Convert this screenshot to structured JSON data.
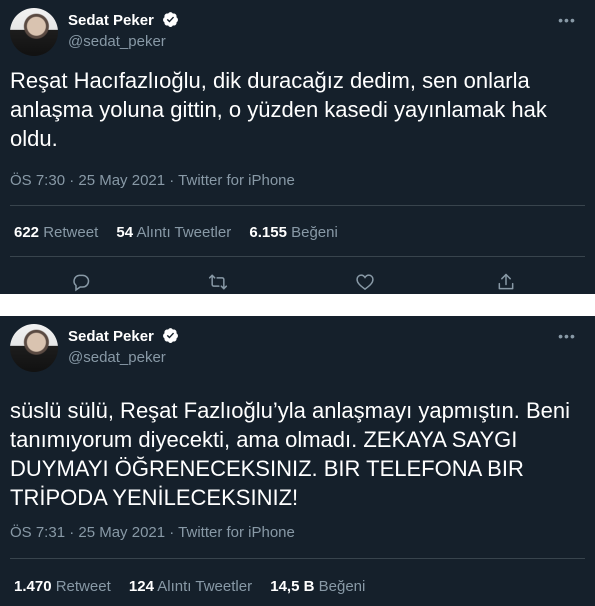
{
  "tweets": [
    {
      "display_name": "Sedat Peker",
      "handle": "@sedat_peker",
      "text": "Reşat Hacıfazlıoğlu, dik duracağız dedim, sen onlarla anlaşma yoluna gittin, o yüzden kasedi yayınlamak hak oldu.",
      "meta": "ÖS 7:30 · 25 May 2021 · Twitter for iPhone",
      "retweet_count": "622",
      "retweet_label": "Retweet",
      "quote_count": "54",
      "quote_label": "Alıntı Tweetler",
      "like_count": "6.155",
      "like_label": "Beğeni",
      "actions": [
        "reply-icon",
        "retweet-icon",
        "like-icon",
        "share-icon"
      ]
    },
    {
      "display_name": "Sedat Peker",
      "handle": "@sedat_peker",
      "text": "süslü sülü, Reşat Fazlıoğlu’yla anlaşmayı yapmıştın. Beni tanımıyorum diyecekti, ama olmadı. ZEKAYA SAYGI DUYMAYI ÖĞRENECEKSINIZ. BIR TELEFONA BIR TRİPODA YENİLECEKSINIZ!",
      "meta": "ÖS 7:31 · 25 May 2021 · Twitter for iPhone",
      "retweet_count": "1.470",
      "retweet_label": "Retweet",
      "quote_count": "124",
      "quote_label": "Alıntı Tweetler",
      "like_count": "14,5 B",
      "like_label": "Beğeni"
    }
  ],
  "colors": {
    "background": "#15202b",
    "text": "#ffffff",
    "secondary": "#8899a6",
    "verified": "#1da1f2",
    "divider": "#38444d"
  }
}
